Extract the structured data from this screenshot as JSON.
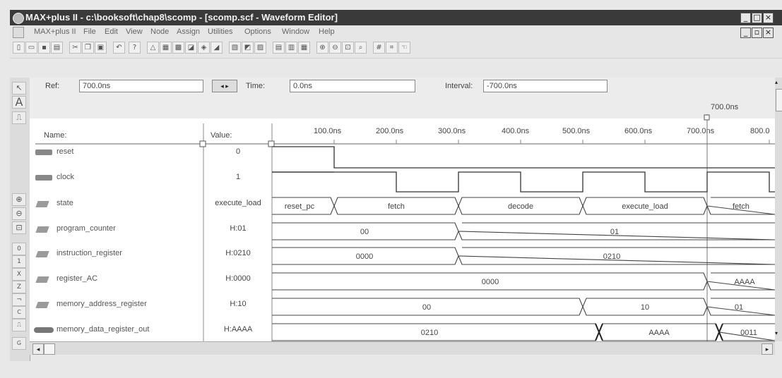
{
  "window": {
    "title": "MAX+plus II - c:\\booksoft\\chap8\\scomp - [scomp.scf - Waveform Editor]",
    "app_icon": "max-plus-icon"
  },
  "menu": [
    "MAX+plus II",
    "File",
    "Edit",
    "View",
    "Node",
    "Assign",
    "Utilities",
    "Options",
    "Window",
    "Help"
  ],
  "toolbar": {
    "icons": [
      "new-icon",
      "open-icon",
      "save-icon",
      "print-icon",
      "cut-icon",
      "copy-icon",
      "paste-icon",
      "undo-icon",
      "help-pointer-icon",
      "hierarchy-icon",
      "floorplan-icon",
      "compile-icon",
      "simulate-icon",
      "timing-icon",
      "program-icon",
      "project-save-icon",
      "project-check-icon",
      "project-compile-icon",
      "open-editor-icon",
      "save-editor-icon",
      "simulate-editor-icon",
      "zoom-in-icon",
      "zoom-out-icon",
      "fit-icon",
      "find-icon",
      "grid-icon",
      "snap-icon",
      "pointer-icon"
    ]
  },
  "timing": {
    "ref_label": "Ref:",
    "ref_value": "700.0ns",
    "time_label": "Time:",
    "time_value": "0.0ns",
    "interval_label": "Interval:",
    "interval_value": "-700.0ns",
    "cursor_label": "700.0ns"
  },
  "columns": {
    "name": "Name:",
    "value": "Value:"
  },
  "time_ticks": [
    "100.0ns",
    "200.0ns",
    "300.0ns",
    "400.0ns",
    "500.0ns",
    "600.0ns",
    "700.0ns",
    "800.0"
  ],
  "signals": [
    {
      "name": "reset",
      "value": "0",
      "type": "input"
    },
    {
      "name": "clock",
      "value": "1",
      "type": "input"
    },
    {
      "name": "state",
      "value": "execute_load",
      "type": "node",
      "segments": [
        "reset_pc",
        "fetch",
        "decode",
        "execute_load",
        "fetch"
      ]
    },
    {
      "name": "program_counter",
      "value": "H:01",
      "type": "node",
      "segments": [
        "00",
        "01"
      ]
    },
    {
      "name": "instruction_register",
      "value": "H:0210",
      "type": "node",
      "segments": [
        "0000",
        "0210"
      ]
    },
    {
      "name": "register_AC",
      "value": "H:0000",
      "type": "node",
      "segments": [
        "0000",
        "AAAA"
      ]
    },
    {
      "name": "memory_address_register",
      "value": "H:10",
      "type": "node",
      "segments": [
        "00",
        "10",
        "01"
      ]
    },
    {
      "name": "memory_data_register_out",
      "value": "H:AAAA",
      "type": "output",
      "segments": [
        "0210",
        "AAAA",
        "0011"
      ]
    }
  ],
  "palette_icons": [
    "selection-icon",
    "text-tool-icon",
    "waveform-tool-icon",
    "zoom-in-icon",
    "zoom-out-icon",
    "fit-in-window-icon",
    "overwrite-low-icon",
    "overwrite-high-icon",
    "overwrite-unknown-icon",
    "overwrite-hiz-icon",
    "invert-icon",
    "count-value-icon",
    "clock-overwrite-icon",
    "group-icon"
  ]
}
